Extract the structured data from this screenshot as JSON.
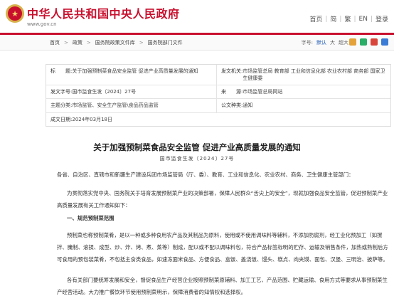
{
  "header": {
    "site_title": "中华人民共和国中央人民政府",
    "site_url": "www.gov.cn",
    "emblem_icon": "national-emblem-icon",
    "lang": [
      "首页",
      "简",
      "繁",
      "EN",
      "登录"
    ]
  },
  "breadcrumb": [
    "首页",
    "政策",
    "国务院政策文件库",
    "国务院部门文件"
  ],
  "font_size_control": {
    "label": "字号:",
    "default": "默认",
    "larger": "大",
    "largest": "超大"
  },
  "meta": {
    "title_key": "标　　题:",
    "title_val": "关于加强预制菜食品安全监管 促进产业高质量发展的通知",
    "issuer_key": "发文机关:",
    "issuer_val": "市场监管总局 教育部 工业和信息化部 农业农村部 商务部 国家卫生健康委",
    "number_key": "发文字号:",
    "number_val": "国市监食生发〔2024〕27号",
    "source_key": "来　　源:",
    "source_val": "市场监管总局网站",
    "topic_key": "主题分类:",
    "topic_val": "市场监管、安全生产监管\\食品药品监管",
    "type_key": "公文种类:",
    "type_val": "通知",
    "date_key": "成文日期:",
    "date_val": "2024年03月18日"
  },
  "document": {
    "title": "关于加强预制菜食品安全监管 促进产业高质量发展的通知",
    "number": "国市监食生发〔2024〕27号",
    "addressees": "各省、自治区、直辖市和新疆生产建设兵团市场监管局（厅、委）、教育、工业和信息化、农业农村、商务、卫生健康主管部门：",
    "para1": "为贯彻落实党中央、国务院关于培育发展预制菜产业的决策部署，保障人民群众“舌尖上的安全”，现就加强食品安全监管，促进预制菜产业高质量发展有关工作通知如下：",
    "heading1": "一、规范预制菜范围",
    "para2": "预制菜也称预制菜肴，是以一种或多种食用农产品及其制品为原料，使用或不使用调味料等辅料，不添加防腐剂，经工业化预加工（如搅拌、腌制、滚揉、成型、炒、炸、烤、煮、蒸等）制成，配以或不配以调味料包，符合产品标签标明的贮存、运输及销售条件，加热或熟制后方可食用的预包装菜肴，不包括主食类食品，如速冻面米食品、方便食品、盒饭、盖浇饭、馒头、糕点、肉夹馍、面包、汉堡、三明治、披萨等。",
    "para3": "各有关部门要统筹发展和安全，督促食品生产经营企业按照预制菜原辅料、加工工艺、产品范围、贮藏运输、食用方式等要求从事预制菜生产经营活动。大力推广餐饮环节使用预制菜明示，保障消费者的知情权和选择权。"
  },
  "colors": {
    "brand_red": "#c8102e",
    "link_blue": "#1a56b3"
  }
}
